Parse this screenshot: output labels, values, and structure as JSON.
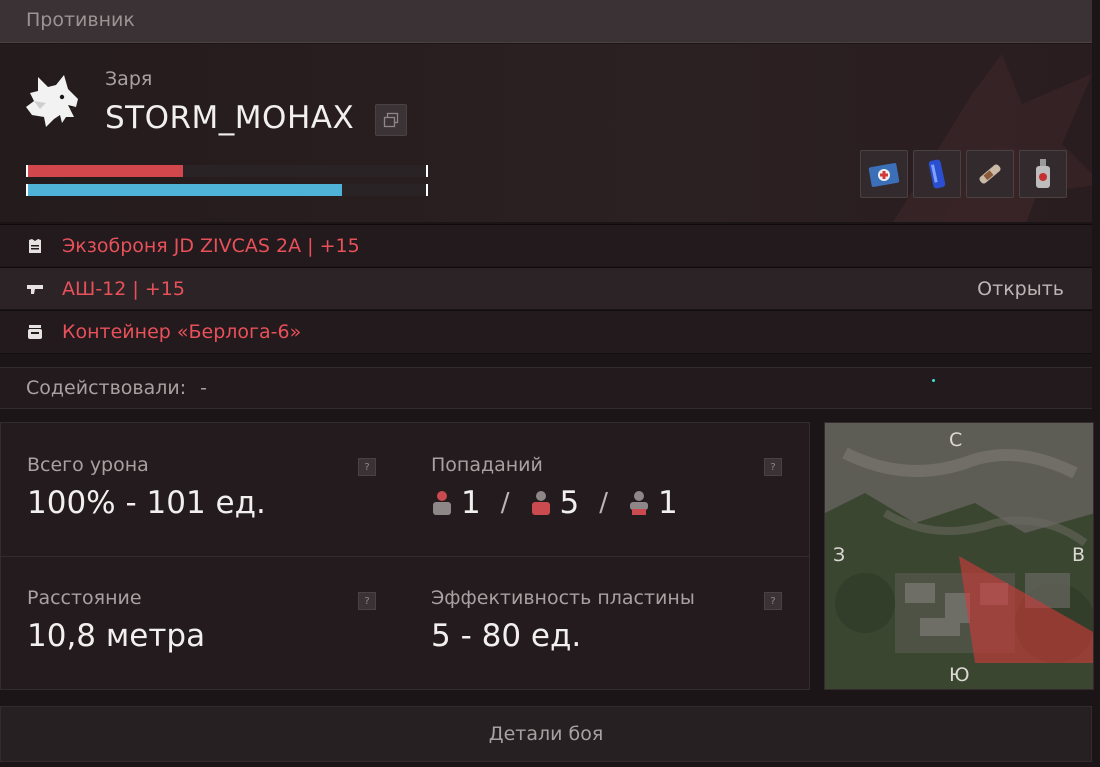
{
  "header": {
    "title": "Противник"
  },
  "player": {
    "faction": "Заря",
    "name": "STORM_MOHAX",
    "health_fraction": 0.39,
    "armor_fraction": 0.79,
    "quick_items": [
      "medkit-icon",
      "battery-icon",
      "syringe-icon",
      "bottle-icon"
    ]
  },
  "equipment": {
    "armor": "Экзоброня JD ZIVCAS 2A | +15",
    "weapon": "АШ-12 | +15",
    "weapon_action": "Открыть",
    "container": "Контейнер «Берлога-6»"
  },
  "assist": {
    "label": "Содействовали:",
    "value": "-"
  },
  "stats": {
    "damage_label": "Всего урона",
    "damage_value": "100% - 101 ед.",
    "hits_label": "Попаданий",
    "hits_head": "1",
    "hits_body": "5",
    "hits_legs": "1",
    "hits_separator": "/",
    "distance_label": "Расстояние",
    "distance_value": "10,8 метра",
    "plate_label": "Эффективность пластины",
    "plate_value": "5 - 80 ед.",
    "help_mark": "?"
  },
  "minimap": {
    "north": "С",
    "south": "Ю",
    "west": "З",
    "east": "В"
  },
  "footer": {
    "details_label": "Детали боя"
  },
  "colors": {
    "accent_red": "#e8505a",
    "health": "#d1474c",
    "armor": "#4fb3d8",
    "view_cone": "#d23a3a"
  }
}
